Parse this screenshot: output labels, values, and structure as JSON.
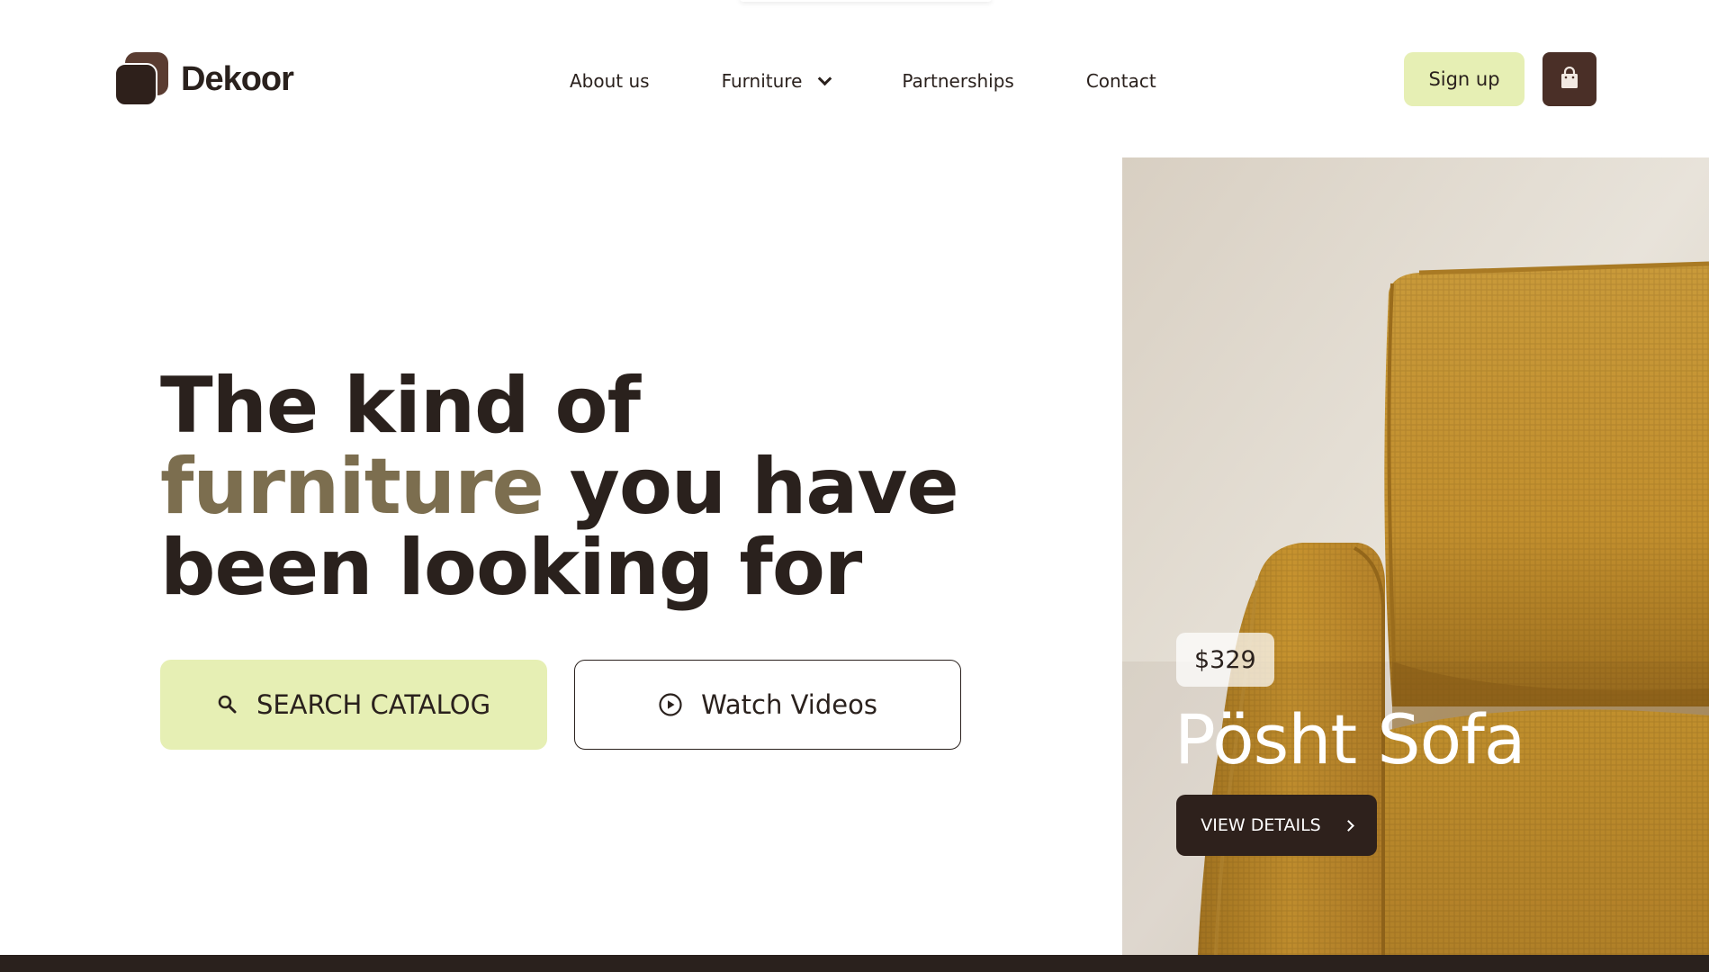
{
  "brand": {
    "name": "Dekoor",
    "colors": {
      "dark": "#2a211d",
      "accent_lime": "#e6efb4",
      "accent_olive": "#7c6e4f",
      "cart_bg": "#4a2f27"
    }
  },
  "nav": {
    "items": [
      {
        "label": "About us"
      },
      {
        "label": "Furniture",
        "has_dropdown": true,
        "icon": "chevron-down-icon"
      },
      {
        "label": "Partnerships"
      },
      {
        "label": "Contact"
      }
    ]
  },
  "header": {
    "signup_label": "Sign up",
    "cart_icon": "shopping-bag-icon"
  },
  "hero": {
    "title_line1": "The kind of",
    "title_accent": "furniture",
    "title_line2_rest": " you have",
    "title_line3": "been looking for",
    "search_label": "SEARCH CATALOG",
    "search_icon": "search-icon",
    "watch_label": "Watch Videos",
    "watch_icon": "play-circle-icon"
  },
  "product": {
    "price": "$329",
    "name": "Pösht Sofa",
    "details_label": "VIEW DETAILS",
    "details_icon": "chevron-right-icon"
  }
}
